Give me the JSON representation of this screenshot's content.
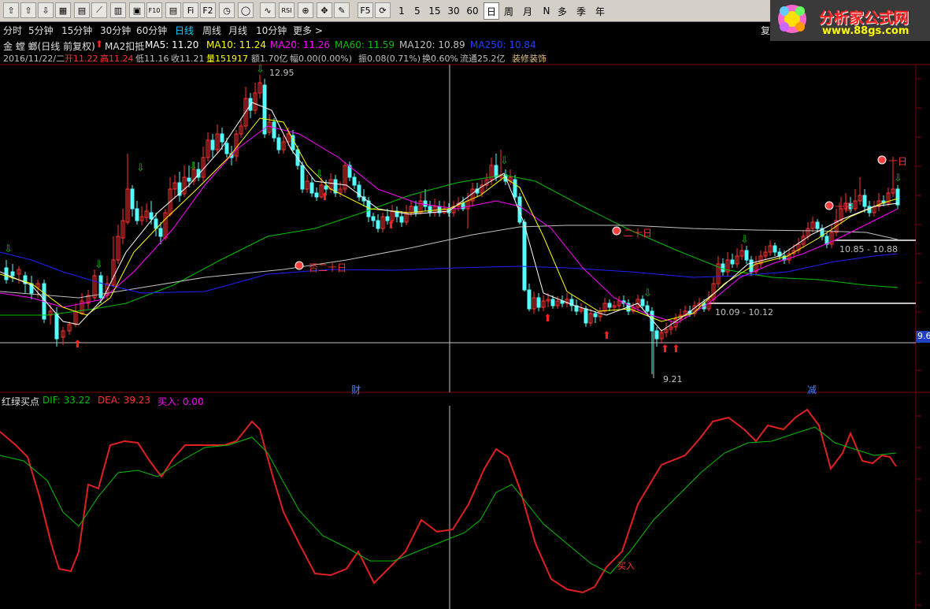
{
  "toolbar": {
    "icons": [
      {
        "name": "back-arrow-icon",
        "glyph": "⇧"
      },
      {
        "name": "up-arrow-icon",
        "glyph": "⇧"
      },
      {
        "name": "down-arrow-icon",
        "glyph": "⇩"
      },
      {
        "name": "grid-icon",
        "glyph": "▦"
      },
      {
        "name": "table-icon",
        "glyph": "▤"
      },
      {
        "name": "line-chart-icon",
        "glyph": "⟋"
      },
      {
        "name": "candle-icon",
        "glyph": "▥"
      },
      {
        "name": "block-icon",
        "glyph": "▣"
      },
      {
        "name": "f10-icon",
        "glyph": "F10"
      },
      {
        "name": "document-icon",
        "glyph": "▤"
      },
      {
        "name": "f-icon",
        "glyph": "Fi"
      },
      {
        "name": "f-icon-2",
        "glyph": "F2"
      },
      {
        "name": "clock-icon",
        "glyph": "◷"
      },
      {
        "name": "circle-icon",
        "glyph": "◯"
      },
      {
        "name": "wave-icon",
        "glyph": "∿"
      },
      {
        "name": "rsi-icon",
        "glyph": "RSI"
      },
      {
        "name": "crosshair-icon",
        "glyph": "⊕"
      },
      {
        "name": "move-icon",
        "glyph": "✥"
      },
      {
        "name": "pen-icon",
        "glyph": "✎"
      },
      {
        "name": "f5-icon",
        "glyph": "F5"
      },
      {
        "name": "refresh-icon",
        "glyph": "⟳"
      }
    ],
    "periods": [
      "1",
      "5",
      "15",
      "30",
      "60",
      "日",
      "周",
      "月",
      "N",
      "多",
      "季",
      "年"
    ],
    "selected_period": "日"
  },
  "logo": {
    "title": "分析家公式网",
    "url": "www.88gs.com"
  },
  "period_bar": [
    "分时",
    "5分钟",
    "15分钟",
    "30分钟",
    "60分钟",
    "日线",
    "周线",
    "月线",
    "10分钟",
    "更多 >"
  ],
  "right_tab": "复",
  "header": {
    "stock": "金 螳 螂(日线 前复权)",
    "ma2": "MA2扣抵",
    "ma5": "MA5: 11.20",
    "ma10": "MA10: 11.24",
    "ma20": "MA20: 11.26",
    "ma60": "MA60: 11.59",
    "ma120": "MA120: 10.89",
    "ma250": "MA250: 10.84",
    "line2_date": "2016/11/22/二",
    "line2_open": "开11.22",
    "line2_high": "高11.24",
    "line2_low": "低11.16",
    "line2_close": "收11.21",
    "line2_vol": "量151917",
    "line2_amt": "额1.70亿",
    "line2_chg": "幅0.00(0.00%)",
    "line2_amp": "振0.08(0.71%)",
    "line2_turn": "换0.60%",
    "line2_float": "流通25.2亿",
    "line2_ind": "装修装饰"
  },
  "labels": {
    "high_label": "12.95",
    "low_label": "9.21",
    "range1": "10.09 - 10.12",
    "range2": "10.85 - 10.88",
    "price_tag": "9.6",
    "cai": "财",
    "jian": "减",
    "note1": "否二十日",
    "note2": "二十日",
    "note3": "十日",
    "note4": "十日"
  },
  "indicator": {
    "name": "红绿买点",
    "dif": "DIF: 33.22",
    "dea": "DEA: 39.23",
    "buy": "买入: 0.00",
    "buy_mark": "买入"
  },
  "colors": {
    "up": "#ff3333",
    "down": "#54ffff",
    "ma5": "#ffffff",
    "ma10": "#ffff00",
    "ma20": "#ff00ff",
    "ma60": "#00c000",
    "ma120": "#c0c0c0",
    "ma250": "#2020ff"
  }
}
